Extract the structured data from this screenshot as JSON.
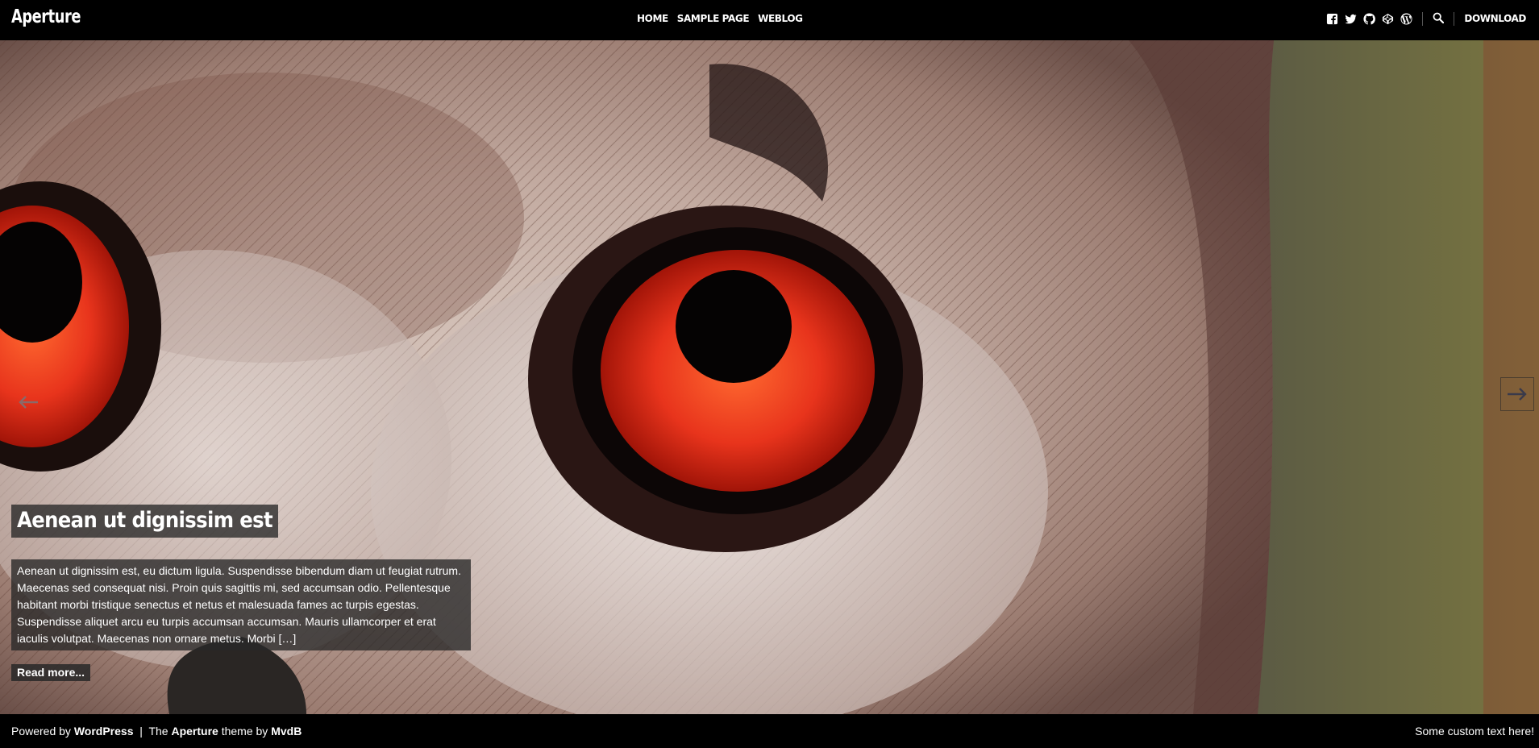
{
  "site": {
    "title": "Aperture"
  },
  "nav": {
    "items": [
      {
        "label": "HOME"
      },
      {
        "label": "SAMPLE PAGE"
      },
      {
        "label": "WEBLOG"
      }
    ]
  },
  "header": {
    "social_icons": [
      "facebook-icon",
      "twitter-icon",
      "github-icon",
      "codepen-icon",
      "wordpress-icon"
    ],
    "search_icon": "search-icon",
    "download_label": "DOWNLOAD"
  },
  "slider": {
    "prev_icon": "arrow-left-icon",
    "next_icon": "arrow-right-icon",
    "slide": {
      "title": "Aenean ut dignissim est",
      "excerpt": "Aenean ut dignissim est, eu dictum ligula. Suspendisse bibendum diam ut feugiat rutrum. Maecenas sed consequat nisi. Proin quis sagittis mi, sed accumsan odio. Pellentesque habitant morbi tristique senectus et netus et malesuada fames ac turpis egestas. Suspendisse aliquet arcu eu turpis accumsan accumsan. Mauris ullamcorper et erat iaculis volutpat. Maecenas non ornare metus. Morbi […]",
      "read_more": "Read more..."
    }
  },
  "footer": {
    "powered_by": "Powered by",
    "wordpress": "WordPress",
    "separator": "|",
    "the": "The",
    "theme_name": "Aperture",
    "theme_by": "theme by",
    "author": "MvdB",
    "custom_text": "Some custom text here!"
  },
  "colors": {
    "background": "#000000",
    "overlay": "#282828",
    "text": "#ffffff",
    "owl_eye": "#e8341c"
  }
}
